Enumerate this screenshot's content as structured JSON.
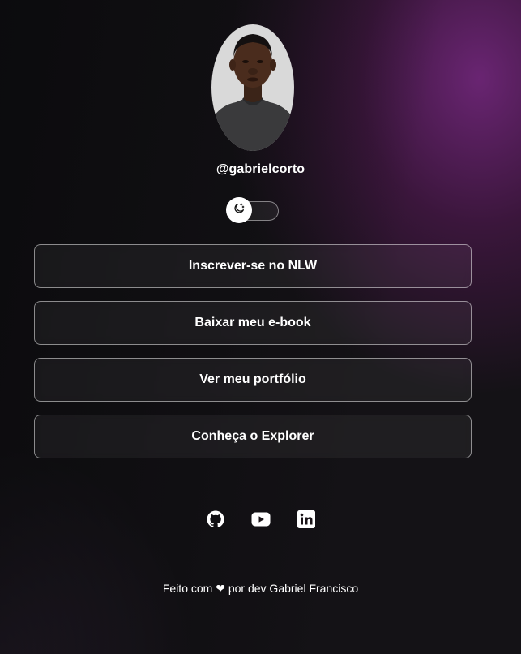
{
  "profile": {
    "username": "@gabrielcorto",
    "avatar_alt": "Foto de perfil"
  },
  "theme_switch": {
    "icon": "moon-icon",
    "state": "dark"
  },
  "links": [
    {
      "label": "Inscrever-se no NLW"
    },
    {
      "label": "Baixar meu e-book"
    },
    {
      "label": "Ver meu portfólio"
    },
    {
      "label": "Conheça o Explorer"
    }
  ],
  "social": [
    {
      "icon": "github-icon"
    },
    {
      "icon": "youtube-icon"
    },
    {
      "icon": "linkedin-icon"
    }
  ],
  "footer": {
    "prefix": "Feito com",
    "heart": "❤",
    "suffix": "por dev Gabriel Francisco"
  },
  "colors": {
    "background": "#141216",
    "accent_glow": "#78288A",
    "text": "#FFFFFF",
    "button_border": "#FFFFFF80"
  }
}
